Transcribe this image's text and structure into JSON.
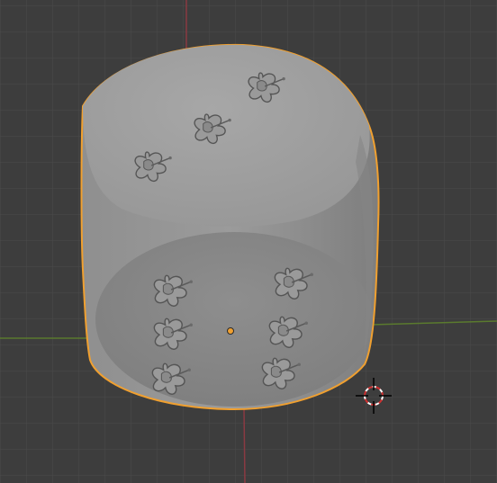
{
  "app": {
    "name": "",
    "view": "3D Viewport"
  },
  "viewport": {
    "background_color": "#3d3d3d",
    "grid_color": "#4a4a4a",
    "x_axis_color": "#8a3a42",
    "y_axis_color": "#5a7a2e",
    "selection_outline_color": "#f0a030",
    "grid_visible": true
  },
  "object": {
    "type": "dice-like cylinder",
    "selected": true,
    "top_face_pips": 3,
    "front_face_pips": 6,
    "pip_motif": "hibiscus-flower"
  },
  "scene_items": [
    {
      "name": "3d-cursor",
      "icon": "crosshair-icon"
    },
    {
      "name": "object-origin",
      "icon": "origin-dot-icon",
      "color": "#f0a030"
    }
  ]
}
